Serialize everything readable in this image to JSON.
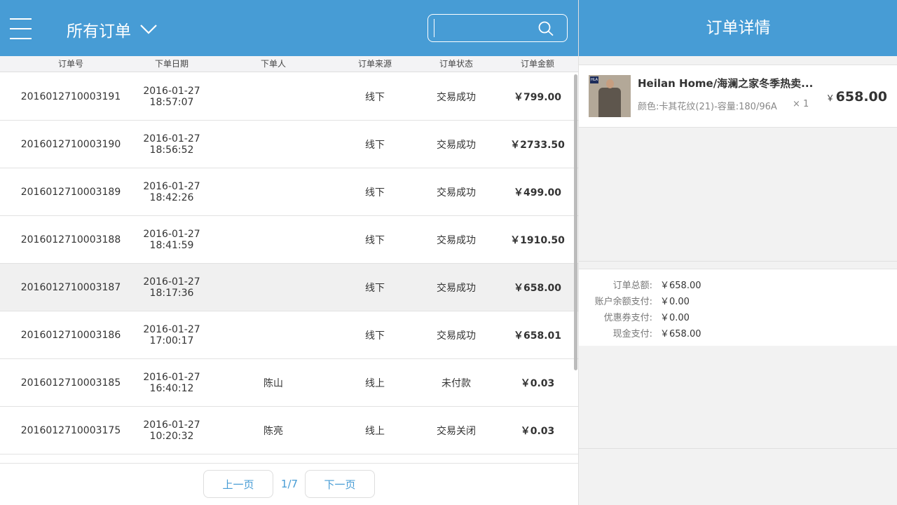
{
  "header": {
    "filter_label": "所有订单",
    "search": {
      "placeholder": "",
      "value": ""
    }
  },
  "table": {
    "columns": [
      "订单号",
      "下单日期",
      "下单人",
      "订单来源",
      "订单状态",
      "订单金额"
    ],
    "rows": [
      {
        "order_no": "2016012710003191",
        "date": "2016-01-27",
        "time": "18:57:07",
        "customer": "",
        "source": "线下",
        "status": "交易成功",
        "amount": "￥799.00"
      },
      {
        "order_no": "2016012710003190",
        "date": "2016-01-27",
        "time": "18:56:52",
        "customer": "",
        "source": "线下",
        "status": "交易成功",
        "amount": "￥2733.50"
      },
      {
        "order_no": "2016012710003189",
        "date": "2016-01-27",
        "time": "18:42:26",
        "customer": "",
        "source": "线下",
        "status": "交易成功",
        "amount": "￥499.00"
      },
      {
        "order_no": "2016012710003188",
        "date": "2016-01-27",
        "time": "18:41:59",
        "customer": "",
        "source": "线下",
        "status": "交易成功",
        "amount": "￥1910.50"
      },
      {
        "order_no": "2016012710003187",
        "date": "2016-01-27",
        "time": "18:17:36",
        "customer": "",
        "source": "线下",
        "status": "交易成功",
        "amount": "￥658.00",
        "selected": true
      },
      {
        "order_no": "2016012710003186",
        "date": "2016-01-27",
        "time": "17:00:17",
        "customer": "",
        "source": "线下",
        "status": "交易成功",
        "amount": "￥658.01"
      },
      {
        "order_no": "2016012710003185",
        "date": "2016-01-27",
        "time": "16:40:12",
        "customer": "陈山",
        "source": "线上",
        "status": "未付款",
        "amount": "￥0.03"
      },
      {
        "order_no": "2016012710003175",
        "date": "2016-01-27",
        "time": "10:20:32",
        "customer": "陈亮",
        "source": "线上",
        "status": "交易关闭",
        "amount": "￥0.03"
      }
    ]
  },
  "pager": {
    "prev_label": "上一页",
    "page_indicator": "1/7",
    "next_label": "下一页"
  },
  "detail": {
    "title": "订单详情",
    "item": {
      "name": "Heilan Home/海澜之家冬季热卖...",
      "spec": "颜色:卡其花纹(21)-容量:180/96A",
      "qty": "× 1",
      "currency": "￥",
      "price": "658.00"
    },
    "summary": [
      {
        "label": "订单总额:",
        "value": "￥658.00"
      },
      {
        "label": "账户余额支付:",
        "value": "￥0.00"
      },
      {
        "label": "优惠券支付:",
        "value": "￥0.00"
      },
      {
        "label": "现金支付:",
        "value": "￥658.00"
      }
    ]
  },
  "colors": {
    "header_bg": "#479cd5",
    "accent": "#479cd5",
    "selected_row": "#f0f0f0"
  },
  "icons": [
    "menu-icon",
    "chevron-down-icon",
    "search-icon"
  ]
}
